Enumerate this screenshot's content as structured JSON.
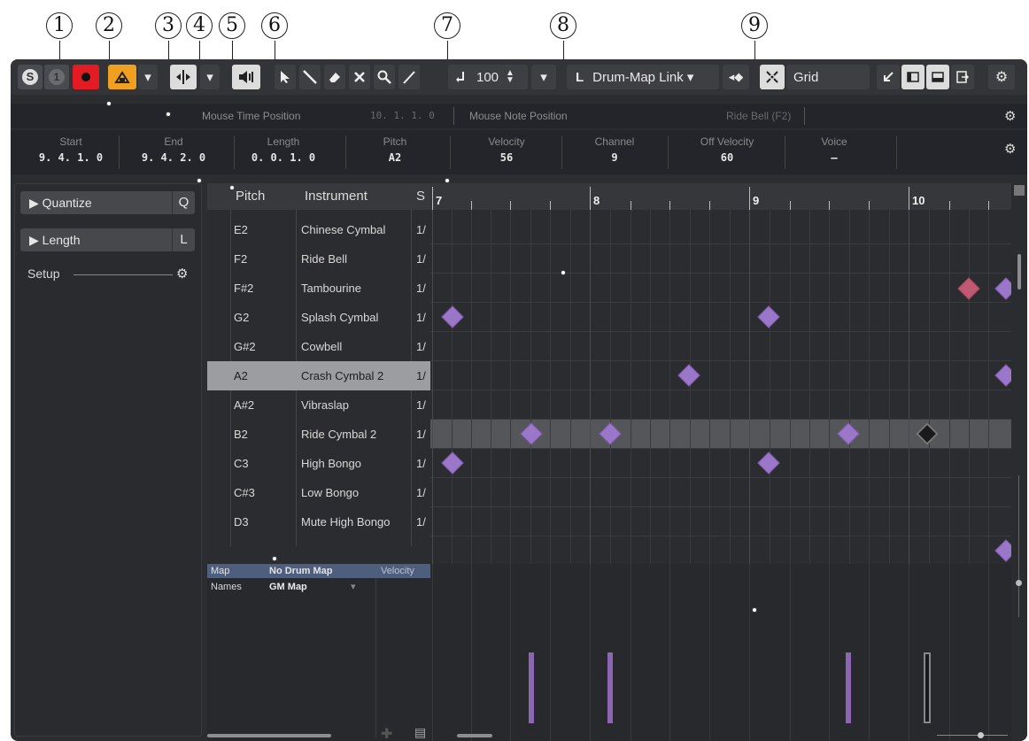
{
  "callouts": [
    "1",
    "2",
    "3",
    "4",
    "5",
    "6",
    "7",
    "8",
    "9"
  ],
  "toolbar": {
    "solo_label": "S",
    "listen_label": "1",
    "tempo_value": "100",
    "drum_map_link_label": "Drum-Map Link ▾",
    "grid_label": "Grid",
    "dropdown_glyph": "▾"
  },
  "info_line": {
    "mouse_time_label": "Mouse Time Position",
    "mouse_time_value": "10. 1. 1.  0",
    "mouse_note_label": "Mouse Note Position",
    "mouse_note_value": "Ride Bell (F2)"
  },
  "event_info": [
    {
      "label": "Start",
      "value": "9. 4. 1.  0"
    },
    {
      "label": "End",
      "value": "9. 4. 2.  0"
    },
    {
      "label": "Length",
      "value": "0. 0. 1.  0"
    },
    {
      "label": "Pitch",
      "value": "A2"
    },
    {
      "label": "Velocity",
      "value": "56"
    },
    {
      "label": "Channel",
      "value": "9"
    },
    {
      "label": "Off Velocity",
      "value": "60"
    },
    {
      "label": "Voice",
      "value": "—"
    }
  ],
  "left_zone": {
    "quantize_label": "▶  Quantize",
    "quantize_key": "Q",
    "length_label": "▶  Length",
    "length_key": "L",
    "setup_label": "Setup"
  },
  "drum_list": {
    "headers": {
      "pitch": "Pitch",
      "instrument": "Instrument",
      "s": "S"
    },
    "rows": [
      {
        "pitch": "E2",
        "instrument": "Chinese Cymbal",
        "q": "1/"
      },
      {
        "pitch": "F2",
        "instrument": "Ride Bell",
        "q": "1/"
      },
      {
        "pitch": "F#2",
        "instrument": "Tambourine",
        "q": "1/"
      },
      {
        "pitch": "G2",
        "instrument": "Splash Cymbal",
        "q": "1/"
      },
      {
        "pitch": "G#2",
        "instrument": "Cowbell",
        "q": "1/"
      },
      {
        "pitch": "A2",
        "instrument": "Crash Cymbal 2",
        "q": "1/"
      },
      {
        "pitch": "A#2",
        "instrument": "Vibraslap",
        "q": "1/"
      },
      {
        "pitch": "B2",
        "instrument": "Ride Cymbal 2",
        "q": "1/"
      },
      {
        "pitch": "C3",
        "instrument": "High Bongo",
        "q": "1/"
      },
      {
        "pitch": "C#3",
        "instrument": "Low Bongo",
        "q": "1/"
      },
      {
        "pitch": "D3",
        "instrument": "Mute High Bongo",
        "q": "1/"
      }
    ]
  },
  "ruler": {
    "bars": [
      "7",
      "8",
      "9",
      "10"
    ]
  },
  "controller": {
    "map_label": "Map",
    "map_value": "No Drum Map",
    "names_label": "Names",
    "names_value": "GM Map",
    "lane_label": "Velocity"
  }
}
